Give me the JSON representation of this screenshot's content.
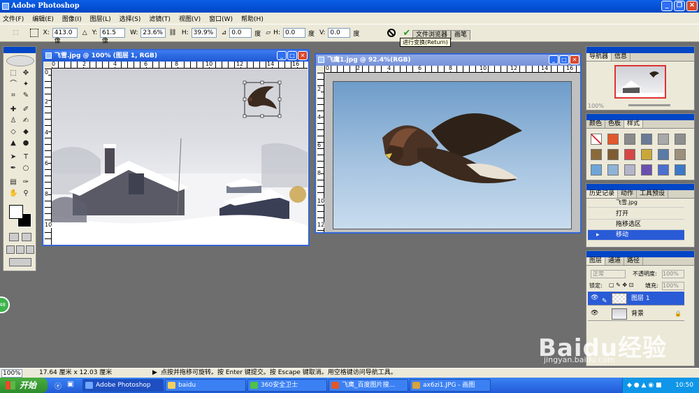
{
  "app": {
    "title": "Adobe Photoshop"
  },
  "menu": [
    "文件(F)",
    "编辑(E)",
    "图像(I)",
    "图层(L)",
    "选择(S)",
    "滤镜(T)",
    "视图(V)",
    "窗口(W)",
    "帮助(H)"
  ],
  "options": {
    "x_label": "X:",
    "x_value": "413.0 像",
    "y_label": "Y:",
    "y_value": "61.5 像",
    "w_label": "W:",
    "w_value": "23.6%",
    "h_label": "H:",
    "h_value": "39.9%",
    "rotate_value": "0.0",
    "rotate_unit": "度",
    "hskew_label": "H:",
    "hskew_value": "0.0",
    "hskew_unit": "度",
    "vskew_label": "V:",
    "vskew_value": "0.0",
    "vskew_unit": "度",
    "tooltip": "进行变换(Return)",
    "well_tabs": [
      "文件浏览器",
      "画笔"
    ]
  },
  "doc1": {
    "title": "飞雪.jpg @ 100% (图层 1, RGB)",
    "ruler_h": [
      "0",
      "2",
      "4",
      "6",
      "8",
      "10",
      "12",
      "14",
      "16"
    ],
    "ruler_v": [
      "0",
      "2",
      "4",
      "6",
      "8",
      "10"
    ]
  },
  "doc2": {
    "title": "飞鹰1.jpg @ 92.4%(RGB)",
    "ruler_h": [
      "0",
      "2",
      "4",
      "6",
      "8",
      "10",
      "12",
      "14",
      "16"
    ],
    "ruler_v": [
      "2",
      "4",
      "6",
      "8",
      "10",
      "12"
    ]
  },
  "navigator": {
    "tabs": [
      "导航器",
      "信息"
    ],
    "zoom": "100%"
  },
  "color_panel": {
    "tabs": [
      "颜色",
      "色板",
      "样式"
    ],
    "styles": [
      "#ffffff",
      "#e2572b",
      "#8a8a8a",
      "#6a7b96",
      "#a9a9a9",
      "#8e8e8e",
      "#8b6a3a",
      "#7f5c33",
      "#d84545",
      "#c9a83a",
      "#5a7aa8",
      "#9c8f7c",
      "#6ea6d9",
      "#8fb3d6",
      "#b5b5c9",
      "#6a4fb0",
      "#4c6fd0",
      "#3c79c8"
    ]
  },
  "history": {
    "tabs": [
      "历史记录",
      "动作",
      "工具预设"
    ],
    "snapshot": "飞雪.jpg",
    "items": [
      "打开",
      "拖移选区",
      "移动"
    ]
  },
  "layers": {
    "tabs": [
      "图层",
      "通道",
      "路径"
    ],
    "blend_mode": "正常",
    "opacity_label": "不透明度:",
    "opacity": "100%",
    "lock_label": "锁定:",
    "fill_label": "填充:",
    "fill": "100%",
    "items": [
      {
        "name": "图层 1",
        "active": true
      },
      {
        "name": "背景",
        "active": false
      }
    ]
  },
  "status": {
    "zoom": "100%",
    "doc_size": "17.64 厘米 x 12.03 厘米",
    "hint": "点按并拖移可旋转。按 Enter 键提交。按 Escape 键取消。用空格键访问导航工具。"
  },
  "taskbar": {
    "start": "开始",
    "tasks": [
      "Adobe Photoshop",
      "baidu",
      "360安全卫士",
      "飞鹰_百度图片搜...",
      "ax6zi1.JPG - 画图"
    ],
    "clock": "10:50"
  },
  "watermark": {
    "main": "Baidu经验",
    "sub": "jingyan.baidu.com"
  },
  "side_badge": "48",
  "colors": {
    "xp_blue": "#0046c6",
    "panel_bg": "#ece9d8",
    "workspace": "#6e6e6e",
    "selected": "#2a5bd7"
  }
}
